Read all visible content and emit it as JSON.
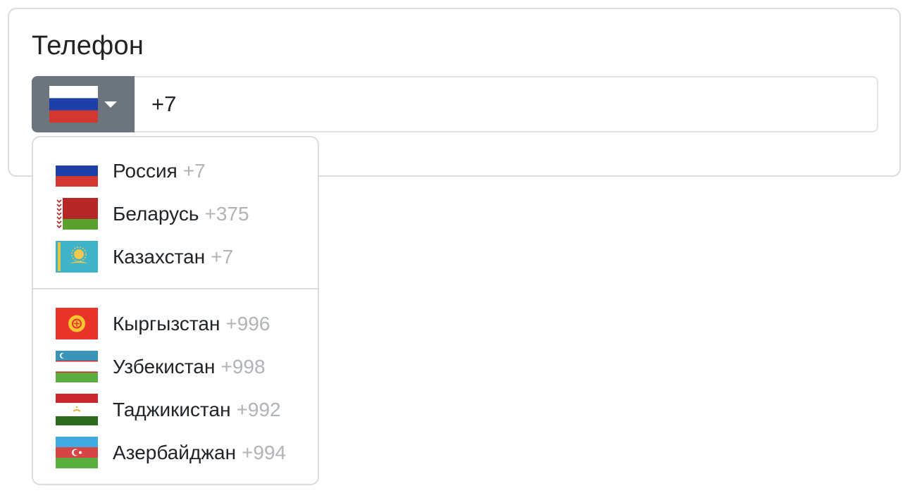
{
  "field": {
    "label": "Телефон",
    "selected_flag": "russia-flag-icon",
    "value": "+7"
  },
  "dropdown": {
    "groups": [
      [
        {
          "name": "Россия",
          "code": "+7",
          "flag": "russia-flag-icon"
        },
        {
          "name": "Беларусь",
          "code": "+375",
          "flag": "belarus-flag-icon"
        },
        {
          "name": "Казахстан",
          "code": "+7",
          "flag": "kazakhstan-flag-icon"
        }
      ],
      [
        {
          "name": "Кыргызстан",
          "code": "+996",
          "flag": "kyrgyzstan-flag-icon"
        },
        {
          "name": "Узбекистан",
          "code": "+998",
          "flag": "uzbekistan-flag-icon"
        },
        {
          "name": "Таджикистан",
          "code": "+992",
          "flag": "tajikistan-flag-icon"
        },
        {
          "name": "Азербайджан",
          "code": "+994",
          "flag": "azerbaijan-flag-icon"
        }
      ]
    ]
  },
  "colors": {
    "toggle_bg": "#6c757d",
    "code_text": "#b0b4b8",
    "border": "#dcdcdc"
  }
}
